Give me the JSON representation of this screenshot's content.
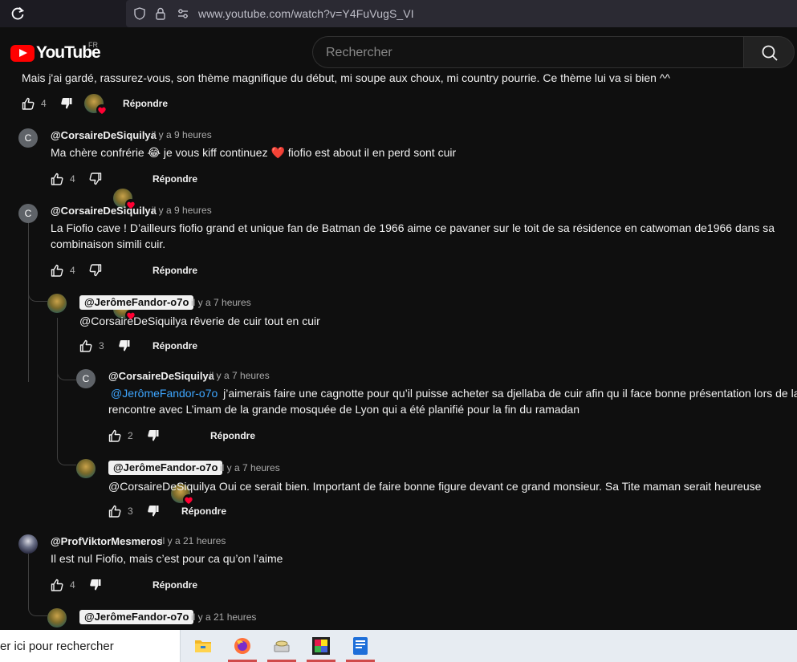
{
  "browser": {
    "url": "www.youtube.com/watch?v=Y4FuVugS_VI"
  },
  "header": {
    "logo_text": "YouTube",
    "country": "FR",
    "search_placeholder": "Rechercher"
  },
  "top_comment": {
    "text": "Mais j'ai gardé, rassurez-vous, son thème magnifique du début, mi soupe aux choux, mi country pourrie. Ce thème lui va si bien ^^",
    "likes": "4",
    "reply_label": "Répondre"
  },
  "comments": [
    {
      "author": "@CorsaireDeSiquilya",
      "time": "il y a 9 heures",
      "text_a": "Ma chère confrérie",
      "text_b": "je vous kiff continuez",
      "text_c": "fiofio est about il en perd sont cuir",
      "likes": "4",
      "reply_label": "Répondre"
    },
    {
      "author": "@CorsaireDeSiquilya",
      "time": "il y a 9 heures",
      "line1": "La Fiofio cave ! D’ailleurs fiofio grand et unique fan de Batman de 1966 aime ce pavaner sur le toit de sa résidence en catwoman de1966 dans sa",
      "line2": "combinaison simili cuir.",
      "likes": "4",
      "reply_label": "Répondre",
      "replies": [
        {
          "author": "@JerômeFandor-o7o",
          "time": "il y a 7 heures",
          "text": "@CorsaireDeSiquilya rêverie de cuir tout en cuir",
          "likes": "3",
          "reply_label": "Répondre"
        },
        {
          "author": "@CorsaireDeSiquilya",
          "time": "il y a 7 heures",
          "mention": "@JerômeFandor-o7o",
          "line1": "j’aimerais faire une cagnotte pour qu’il puisse acheter sa djellaba de cuir afin qu il face bonne présentation lors de la",
          "line2": "rencontre avec L’imam de la grande mosquée de Lyon qui a été planifié pour la fin du ramadan",
          "likes": "2",
          "reply_label": "Répondre"
        },
        {
          "author": "@JerômeFandor-o7o",
          "time": "il y a 7 heures",
          "text": "@CorsaireDeSiquilya Oui ce serait bien. Important de faire bonne figure devant ce grand monsieur. Sa Tite maman serait heureuse",
          "likes": "3",
          "reply_label": "Répondre"
        }
      ]
    },
    {
      "author": "@ProfViktorMesmeros",
      "time": "il y a 21 heures",
      "text": "Il est nul Fiofio, mais c’est pour ca qu’on l’aime",
      "likes": "4",
      "reply_label": "Répondre",
      "replies": [
        {
          "author": "@JerômeFandor-o7o",
          "time": "il y a 21 heures"
        }
      ]
    }
  ],
  "taskbar": {
    "search_text": "er ici pour rechercher"
  },
  "colors": {
    "background": "#0f0f0f",
    "text": "#f1f1f1",
    "muted": "#aaaaaa",
    "mention": "#3ea6ff",
    "brand": "#ff0000"
  }
}
